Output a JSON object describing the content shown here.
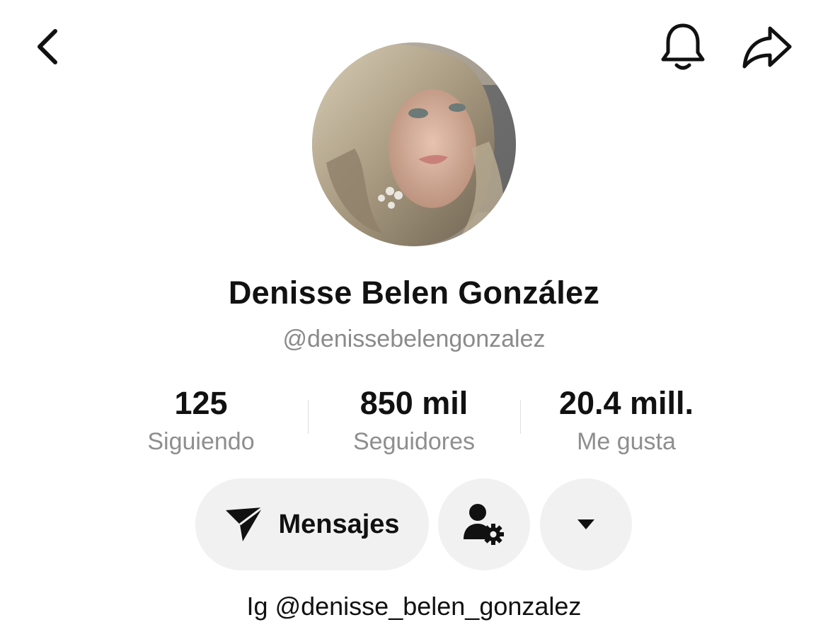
{
  "header": {
    "back_icon": "chevron-left-icon",
    "bell_icon": "bell-icon",
    "share_icon": "share-arrow-icon"
  },
  "profile": {
    "display_name": "Denisse Belen González",
    "username": "@denissebelengonzalez"
  },
  "stats": {
    "following": {
      "value": "125",
      "label": "Siguiendo"
    },
    "followers": {
      "value": "850 mil",
      "label": "Seguidores"
    },
    "likes": {
      "value": "20.4 mill.",
      "label": "Me gusta"
    }
  },
  "actions": {
    "message_label": "Mensajes",
    "message_icon": "send-icon",
    "user_settings_icon": "user-gear-icon",
    "more_icon": "caret-down-icon"
  },
  "bio": "Ig @denisse_belen_gonzalez",
  "colors": {
    "text_primary": "#111111",
    "text_secondary": "#8a8a8a",
    "button_bg": "#f1f1f1",
    "divider": "#dedede"
  }
}
